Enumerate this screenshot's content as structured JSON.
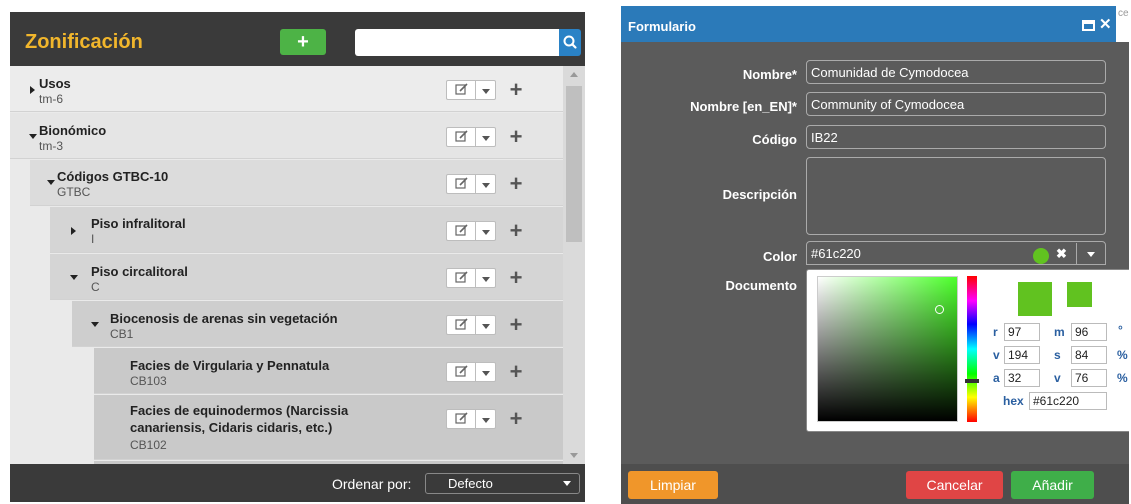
{
  "left_panel": {
    "title": "Zonificación",
    "add_label": "+",
    "search_placeholder": "",
    "sort_label": "Ordenar por:",
    "sort_value": "Defecto",
    "tree": [
      {
        "title": "Usos",
        "code": "tm-6",
        "state": "collapsed"
      },
      {
        "title": "Bionómico",
        "code": "tm-3",
        "state": "expanded"
      },
      {
        "title": "Códigos GTBC-10",
        "code": "GTBC",
        "state": "expanded"
      },
      {
        "title": "Piso infralitoral",
        "code": "I",
        "state": "collapsed"
      },
      {
        "title": "Piso circalitoral",
        "code": "C",
        "state": "expanded"
      },
      {
        "title": "Biocenosis de arenas sin vegetación",
        "code": "CB1",
        "state": "expanded"
      },
      {
        "title": "Facies de Virgularia y Pennatula",
        "code": "CB103",
        "state": "leaf"
      },
      {
        "title": "Facies de equinodermos (Narcissia",
        "title_line2": "canariensis, Cidaris cidaris, etc.)",
        "code": "CB102",
        "state": "leaf"
      }
    ]
  },
  "dialog": {
    "title": "Formulario",
    "background_text": "ce",
    "fields": {
      "nombre_label": "Nombre*",
      "nombre_value": "Comunidad de Cymodocea",
      "nombre_en_label": "Nombre [en_EN]*",
      "nombre_en_value": "Community of Cymodocea",
      "codigo_label": "Código",
      "codigo_value": "IB22",
      "descripcion_label": "Descripción",
      "descripcion_value": "",
      "color_label": "Color",
      "color_value": "#61c220",
      "documento_label": "Documento"
    },
    "picker": {
      "r": "97",
      "g": "194",
      "b": "32",
      "h": "96",
      "s": "84",
      "v": "76",
      "hex": "#61c220",
      "r_label": "r",
      "g_label": "v",
      "b_label": "a",
      "h_label": "m",
      "s_label": "s",
      "v_label": "v",
      "hex_label": "hex",
      "deg_unit": "°",
      "pct_unit": "%"
    },
    "buttons": {
      "clear": "Limpiar",
      "cancel": "Cancelar",
      "add": "Añadir"
    }
  },
  "colors": {
    "accent_title": "#f1b62c",
    "add_green": "#4db346",
    "search_blue": "#2a82c6",
    "dialog_blue": "#2b7ab9",
    "selected_color": "#61c220",
    "btn_clear": "#f0962a",
    "btn_cancel": "#e04545",
    "btn_add": "#3fae49"
  },
  "icons": [
    "search-icon",
    "edit-icon",
    "chevron-down-icon",
    "plus-icon",
    "maximize-icon",
    "close-icon",
    "clear-icon"
  ]
}
